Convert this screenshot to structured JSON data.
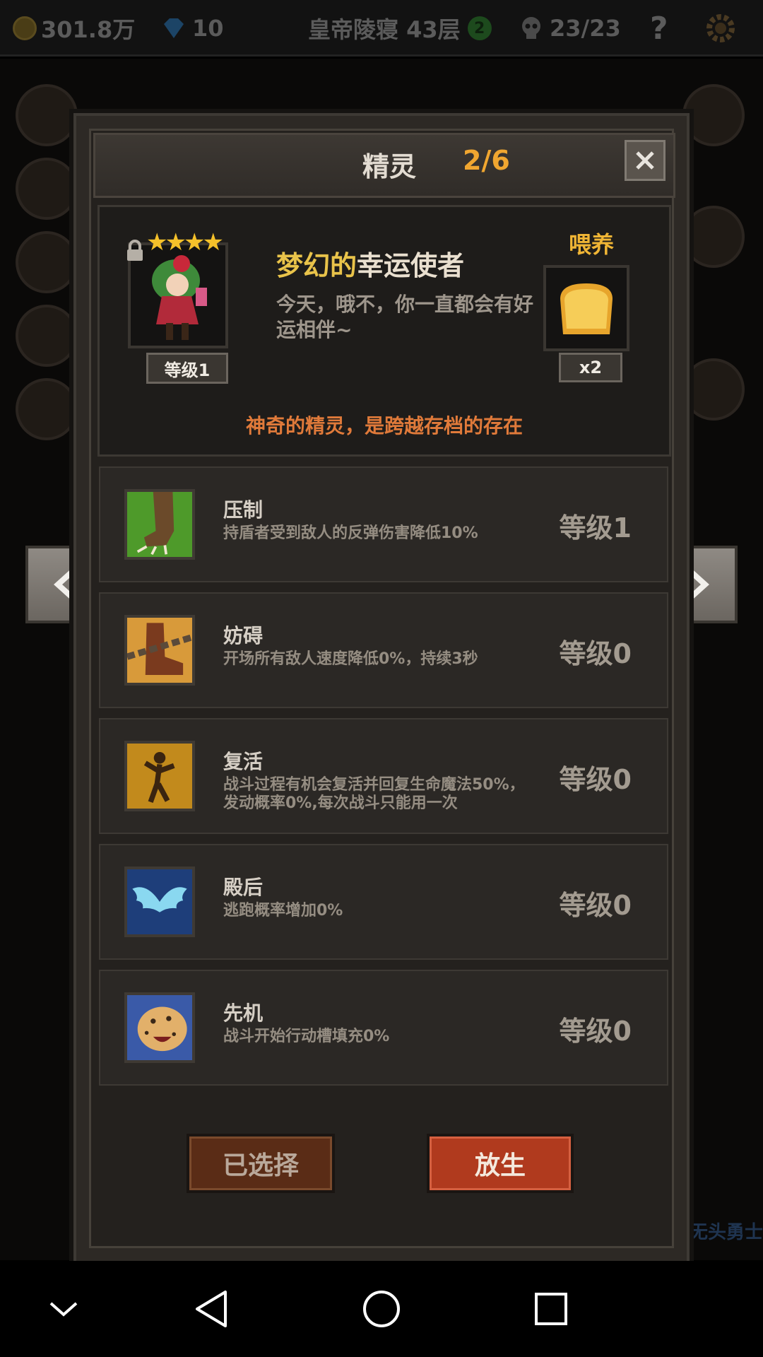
{
  "topbar": {
    "gold": "301.8万",
    "gems": "10",
    "location": "皇帝陵寝 43层",
    "location_badge": "2",
    "skull_count": "23/23",
    "help": "?"
  },
  "background": {
    "side_text": "无头勇士"
  },
  "dialog": {
    "title": "精灵",
    "count": "2/6",
    "pet": {
      "stars": "★★★★",
      "level": "等级1",
      "name_prefix": "梦幻的",
      "name_suffix": "幸运使者",
      "description": "今天，哦不，你一直都会有好运相伴~"
    },
    "feed": {
      "label": "喂养",
      "count": "x2"
    },
    "notice": "神奇的精灵，是跨越存档的存在",
    "skills": [
      {
        "name": "压制",
        "description": "持盾者受到敌人的反弹伤害降低10%",
        "level": "等级1",
        "icon": "claw-icon"
      },
      {
        "name": "妨碍",
        "description": "开场所有敌人速度降低0%，持续3秒",
        "level": "等级0",
        "icon": "chained-boot-icon"
      },
      {
        "name": "复活",
        "description": "战斗过程有机会复活并回复生命魔法50%，发动概率0%,每次战斗只能用一次",
        "level": "等级0",
        "icon": "revive-figure-icon"
      },
      {
        "name": "殿后",
        "description": "逃跑概率增加0%",
        "level": "等级0",
        "icon": "wings-icon"
      },
      {
        "name": "先机",
        "description": "战斗开始行动槽填充0%",
        "level": "等级0",
        "icon": "leopard-icon"
      }
    ],
    "buttons": {
      "selected": "已选择",
      "release": "放生"
    }
  },
  "colors": {
    "accent_orange": "#f0a630",
    "gold_text": "#e9c34a",
    "release_red": "#b03a1e",
    "notice_orange": "#e07a3a"
  }
}
